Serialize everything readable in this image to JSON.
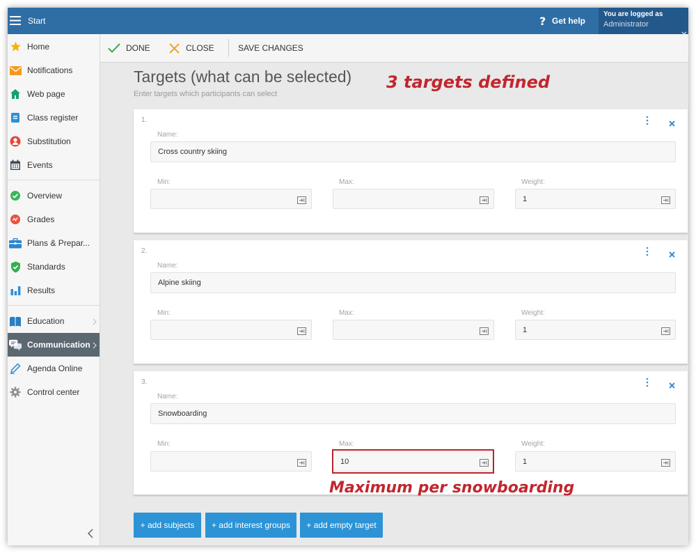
{
  "topbar": {
    "menu_icon": "hamburger-icon",
    "start_label": "Start",
    "help_icon": "question-icon",
    "help_mark": "?",
    "help_label": "Get help",
    "logged_as_label": "You are logged as",
    "user_name": "Administrator",
    "account_menu_icon": "chevron-down-icon"
  },
  "sidebar": {
    "items": [
      {
        "label": "Home",
        "icon": "star-icon"
      },
      {
        "label": "Notifications",
        "icon": "envelope-icon"
      },
      {
        "label": "Web page",
        "icon": "house-icon"
      },
      {
        "label": "Class register",
        "icon": "register-icon"
      },
      {
        "label": "Substitution",
        "icon": "person-icon"
      },
      {
        "label": "Events",
        "icon": "calendar-icon"
      },
      {
        "label": "Overview",
        "icon": "check-circle-icon"
      },
      {
        "label": "Grades",
        "icon": "grades-icon"
      },
      {
        "label": "Plans & Prepar...",
        "icon": "briefcase-icon"
      },
      {
        "label": "Standards",
        "icon": "shield-check-icon"
      },
      {
        "label": "Results",
        "icon": "bar-chart-icon"
      },
      {
        "label": "Education",
        "icon": "book-icon",
        "has_submenu": true
      },
      {
        "label": "Communication",
        "icon": "chat-bubbles-icon",
        "has_submenu": true,
        "active": true
      },
      {
        "label": "Agenda Online",
        "icon": "pencil-icon"
      },
      {
        "label": "Control center",
        "icon": "gear-icon"
      }
    ],
    "collapse_icon": "chevron-left-icon"
  },
  "toolbar": {
    "done_icon": "checkmark-icon",
    "done_label": "DONE",
    "close_icon": "close-icon",
    "close_label": "CLOSE",
    "save_label": "SAVE CHANGES"
  },
  "main": {
    "title": "Targets (what can be selected)",
    "subtitle": "Enter targets which participants can select",
    "targets": [
      {
        "number": "1.",
        "name_label": "Name:",
        "name": "Cross country skiing",
        "min_label": "Min:",
        "min": "",
        "max_label": "Max:",
        "max": "",
        "weight_label": "Weight:",
        "weight": "1"
      },
      {
        "number": "2.",
        "name_label": "Name:",
        "name": "Alpine skiing",
        "min_label": "Min:",
        "min": "",
        "max_label": "Max:",
        "max": "",
        "weight_label": "Weight:",
        "weight": "1"
      },
      {
        "number": "3.",
        "name_label": "Name:",
        "name": "Snowboarding",
        "min_label": "Min:",
        "min": "",
        "max_label": "Max:",
        "max": "10",
        "weight_label": "Weight:",
        "weight": "1"
      }
    ],
    "add_subjects_label": "+ add subjects",
    "add_interest_groups_label": "+ add interest groups",
    "add_empty_target_label": "+ add empty target"
  },
  "annotations": {
    "top_text": "3 targets defined",
    "bottom_text": "Maximum per snowboarding",
    "color": "#c2262e"
  },
  "colors": {
    "topbar": "#2f6ea5",
    "account_box": "#23588b",
    "active_nav": "#5c6870",
    "action_button": "#2b93d6",
    "link_icon": "#3b8ed4",
    "done_check": "#41a84d",
    "close_x": "#f0a12b"
  }
}
